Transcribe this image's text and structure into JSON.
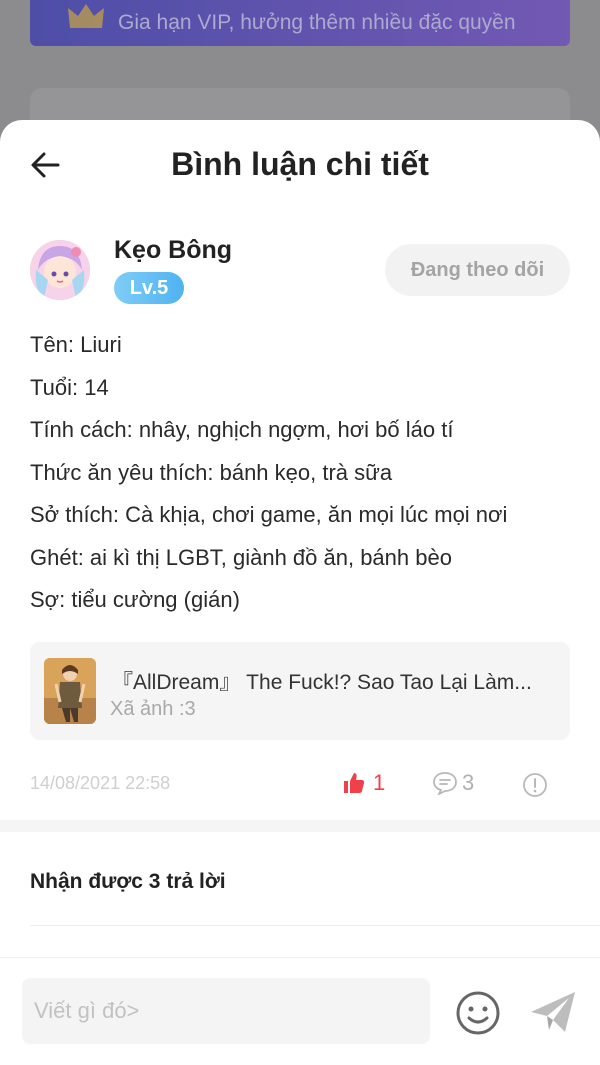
{
  "background": {
    "vip_banner_text": "Gia hạn VIP, hưởng thêm nhiều đặc quyền"
  },
  "sheet": {
    "title": "Bình luận chi tiết"
  },
  "author": {
    "name": "Kẹo Bông",
    "level": "Lv.5",
    "follow_label": "Đang theo dõi"
  },
  "post": {
    "lines": [
      "Tên: Liuri",
      "Tuổi: 14",
      "Tính cách: nhây, nghịch ngợm, hơi bố láo tí",
      "Thức ăn yêu thích: bánh kẹo, trà sữa",
      "Sở thích: Cà khịa, chơi game, ăn mọi lúc mọi nơi",
      "Ghét: ai kì thị LGBT, giành đồ ăn, bánh bèo",
      "Sợ: tiểu cường (gián)"
    ],
    "attachment": {
      "title": "『AllDream』 The Fuck!? Sao Tao Lại Làm...",
      "subtitle": "Xã ảnh :3"
    },
    "timestamp": "14/08/2021 22:58",
    "likes": "1",
    "comments": "3"
  },
  "replies": {
    "label": "Nhận được 3 trả lời"
  },
  "compose": {
    "placeholder": "Viết gì đó>"
  },
  "colors": {
    "like_red": "#f0414a",
    "level_blue": "#4fb2f0",
    "muted_gray": "#a8a8a8"
  }
}
